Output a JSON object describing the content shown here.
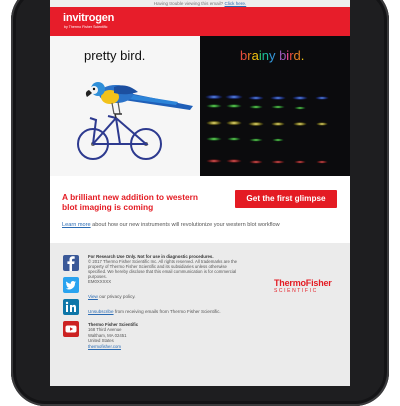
{
  "topline": {
    "text": "Having trouble viewing this email?",
    "link": "Click here."
  },
  "header": {
    "logo": "invitrogen",
    "logo_sub": "by Thermo Fisher Scientific"
  },
  "hero": {
    "left_caption": "pretty bird.",
    "right_caption": "brainy bird."
  },
  "promo": {
    "headline": "A brilliant new addition to western blot imaging is coming",
    "cta_label": "Get the first glimpse"
  },
  "learn": {
    "link": "Learn more",
    "text": " about how our new instruments will revolutionize your western blot workflow"
  },
  "footer": {
    "social": [
      "facebook-icon",
      "twitter-icon",
      "linkedin-icon",
      "youtube-icon"
    ],
    "disclaimer_lead": "For Research Use Only. Not for use in diagnostic procedures.",
    "disclaimer_body": "© 2017 Thermo Fisher Scientific Inc. All rights reserved. All trademarks are the property of Thermo Fisher Scientific and its subsidiaries unless otherwise specified. We hereby disclose that this email communication is for commercial purposes.",
    "code": "EM0XXXXX",
    "policy_link": "View",
    "policy_text": " our privacy policy.",
    "unsub_link": "Unsubscribe",
    "unsub_text": " from receiving emails from Thermo Fisher Scientific.",
    "company": "Thermo Fisher Scientific",
    "street": "168 Third Avenue",
    "city": "Waltham, MA 02451",
    "country": "United States",
    "website": "thermofisher.com",
    "brand_line1": "ThermoFisher",
    "brand_line2": "SCIENTIFIC"
  },
  "colors": {
    "brand_red": "#e41b23",
    "link_blue": "#2a6bb3",
    "device_frame": "#1e1e20"
  }
}
